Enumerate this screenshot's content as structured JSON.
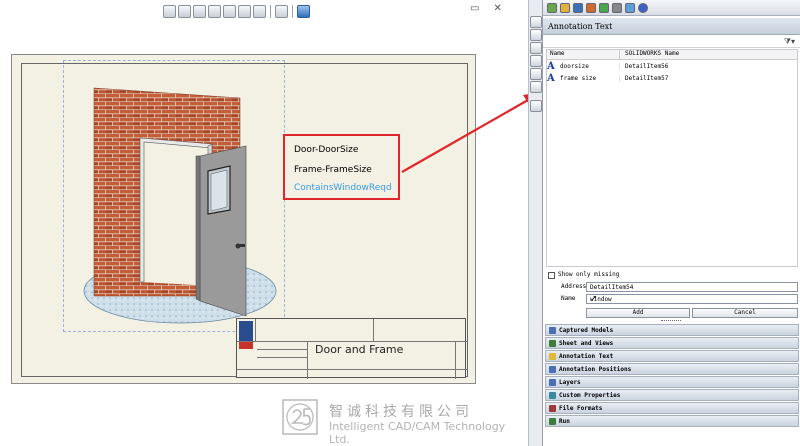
{
  "drawing": {
    "notes": [
      "Door-DoorSize",
      "Frame-FrameSize",
      "ContainsWindowReqd"
    ],
    "title_block": {
      "title": "Door and Frame"
    }
  },
  "watermark": {
    "company_cn": "智诚科技有限公司",
    "company_en": "Intelligent CAD/CAM Technology Ltd."
  },
  "panel": {
    "header": "Annotation Text",
    "filter_icon": "filter-icon",
    "columns": [
      "Name",
      "SOLIDWORKS Name"
    ],
    "rows": [
      {
        "name": "doorsize",
        "sw_name": "DetailItem56"
      },
      {
        "name": "frame size",
        "sw_name": "DetailItem57"
      }
    ],
    "show_only_missing_label": "Show only missing",
    "show_only_missing_checked": false,
    "address_label": "Address",
    "address_value": "DetailItem54",
    "name_label": "Name",
    "name_value": "window",
    "add_label": "Add",
    "cancel_label": "Cancel",
    "sections": [
      {
        "label": "Captured Models",
        "color": "#4a6fb5"
      },
      {
        "label": "Sheet and Views",
        "color": "#3f7d3a"
      },
      {
        "label": "Annotation Text",
        "color": "#e0b83a"
      },
      {
        "label": "Annotation Positions",
        "color": "#4a6fb5"
      },
      {
        "label": "Layers",
        "color": "#4a6fb5"
      },
      {
        "label": "Custom Properties",
        "color": "#3a8a9c"
      },
      {
        "label": "File Formats",
        "color": "#9c3a3a"
      },
      {
        "label": "Run",
        "color": "#3f7d3a"
      }
    ]
  },
  "colors": {
    "callout_border": "#e0262a",
    "arrow": "#e0262a",
    "note_highlight": "#3a9be8"
  }
}
